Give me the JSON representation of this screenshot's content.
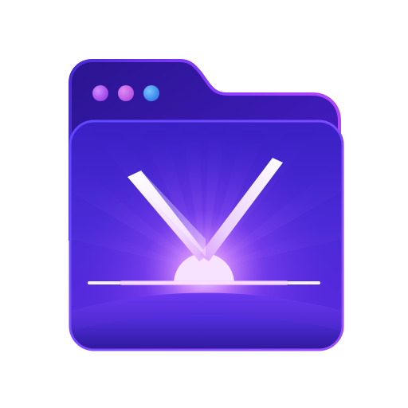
{
  "icon": {
    "name": "folder-app-icon",
    "window_dots": [
      "purple-dot",
      "violet-dot",
      "blue-dot"
    ],
    "emblem": "v-checkmark-icon",
    "colors": {
      "back_panel": "#3d1bb8",
      "back_panel_edge": "#7b3dff",
      "front_panel": "#4a2ad6",
      "front_panel_edge": "#6b35f0",
      "dot_purple": "#a44cf0",
      "dot_violet": "#c05ee8",
      "dot_blue": "#3b8cf0",
      "glow": "#e7c4ff",
      "horizon": "#ffffff"
    }
  }
}
